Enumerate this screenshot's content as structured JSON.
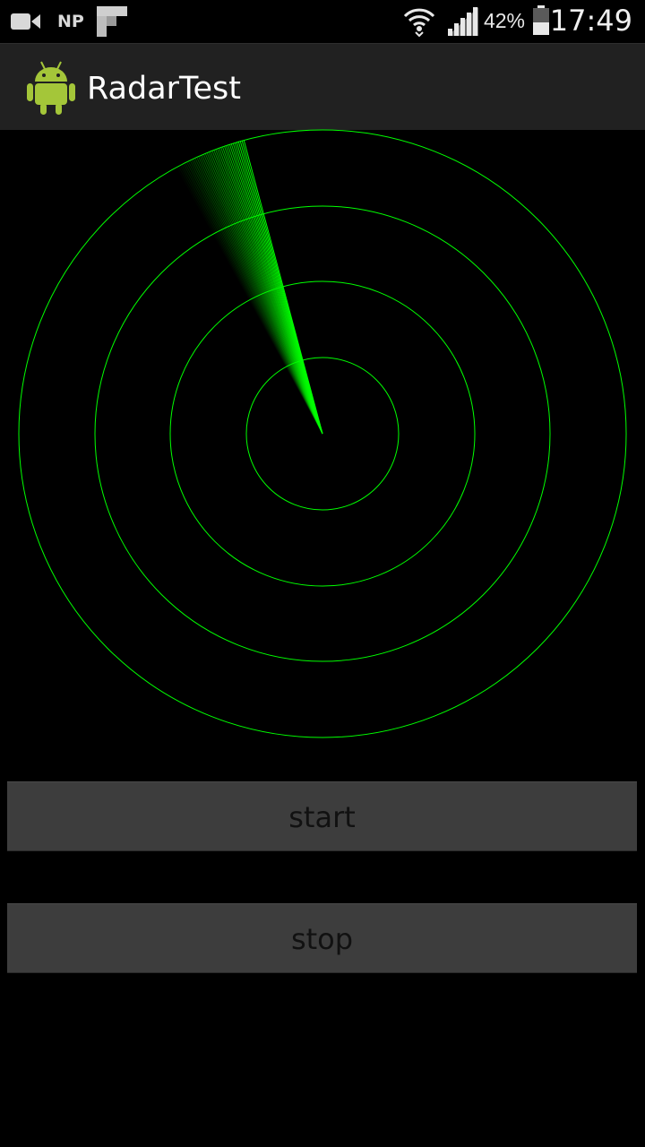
{
  "status_bar": {
    "left_icons": [
      "video-camera-icon",
      "np-indicator",
      "flipboard-icon"
    ],
    "np_label": "NP",
    "battery_percent": "42%",
    "time": "17:49",
    "right_icons": [
      "wifi-icon",
      "signal-icon",
      "battery-icon"
    ]
  },
  "action_bar": {
    "title": "RadarTest",
    "icon": "android-robot-icon"
  },
  "radar": {
    "ring_color": "#00ff00",
    "ring_count": 4,
    "sweep_angle_deg": 345
  },
  "buttons": {
    "start_label": "start",
    "stop_label": "stop"
  },
  "colors": {
    "background": "#000000",
    "action_bar": "#212121",
    "button_bg": "#3d3d3d",
    "radar_green": "#00ff00"
  }
}
